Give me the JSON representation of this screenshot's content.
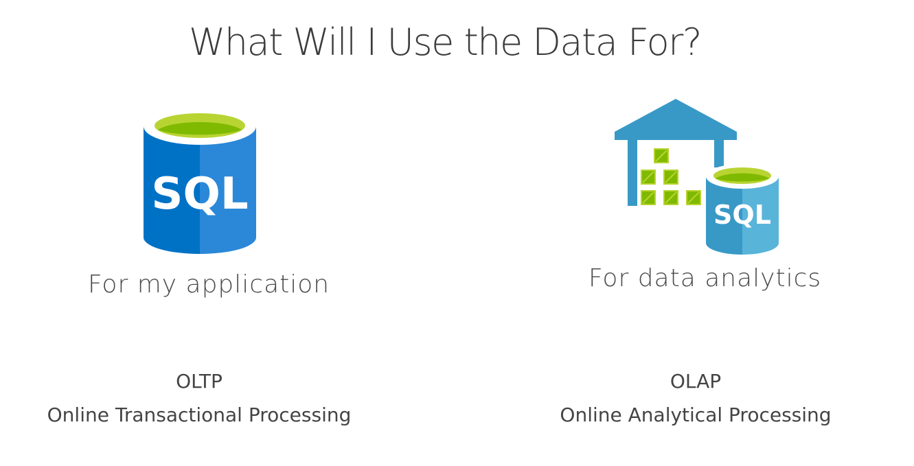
{
  "slide": {
    "title": "What Will I Use the Data For?"
  },
  "left": {
    "icon": "sql-database-icon",
    "icon_text": "SQL",
    "caption": "For my application",
    "acronym": "OLTP",
    "full_name": "Online Transactional Processing"
  },
  "right": {
    "icon": "sql-data-warehouse-icon",
    "icon_text": "SQL",
    "caption": "For data analytics",
    "acronym": "OLAP",
    "full_name": "Online Analytical Processing"
  },
  "colors": {
    "sql_blue_dark": "#0072c6",
    "sql_blue_light": "#2b88d8",
    "sql_green": "#b8d432",
    "sql_green_dark": "#7fba00",
    "warehouse_blue": "#3999c6",
    "warehouse_cyl_light": "#59b4d9",
    "text": "#3c3c3c"
  }
}
